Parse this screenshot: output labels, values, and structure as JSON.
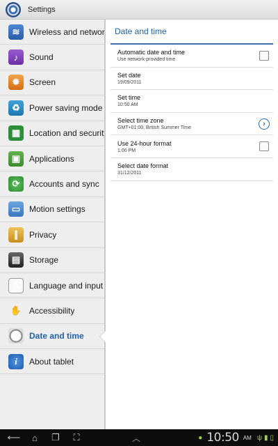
{
  "window": {
    "title": "Settings"
  },
  "sidebar": {
    "items": [
      {
        "label": "Wireless and networks",
        "icon": "wifi-icon",
        "glyph": "≋"
      },
      {
        "label": "Sound",
        "icon": "sound-icon",
        "glyph": "♪"
      },
      {
        "label": "Screen",
        "icon": "screen-icon",
        "glyph": "✹"
      },
      {
        "label": "Power saving mode",
        "icon": "recycle-icon",
        "glyph": "♻"
      },
      {
        "label": "Location and security",
        "icon": "location-grid-icon",
        "glyph": "▦"
      },
      {
        "label": "Applications",
        "icon": "applications-icon",
        "glyph": "▣"
      },
      {
        "label": "Accounts and sync",
        "icon": "sync-icon",
        "glyph": "⟳"
      },
      {
        "label": "Motion settings",
        "icon": "tablet-motion-icon",
        "glyph": "▭"
      },
      {
        "label": "Privacy",
        "icon": "fence-icon",
        "glyph": "∥"
      },
      {
        "label": "Storage",
        "icon": "sd-card-icon",
        "glyph": "▤"
      },
      {
        "label": "Language and input",
        "icon": "keyboard-a-icon",
        "glyph": "A"
      },
      {
        "label": "Accessibility",
        "icon": "hand-icon",
        "glyph": "✋"
      },
      {
        "label": "Date and time",
        "icon": "clock-icon",
        "glyph": "◷",
        "active": true
      },
      {
        "label": "About tablet",
        "icon": "info-icon",
        "glyph": "i"
      }
    ]
  },
  "detail": {
    "header": "Date and time",
    "prefs": [
      {
        "title": "Automatic date and time",
        "summary": "Use network-provided time",
        "widget": "checkbox",
        "checked": false
      },
      {
        "title": "Set date",
        "summary": "19/09/2011",
        "widget": "none"
      },
      {
        "title": "Set time",
        "summary": "10:50 AM",
        "widget": "none"
      },
      {
        "title": "Select time zone",
        "summary": "GMT+01:00, British Summer Time",
        "widget": "chevron"
      },
      {
        "title": "Use 24-hour format",
        "summary": "1:00 PM",
        "widget": "checkbox",
        "checked": false
      },
      {
        "title": "Select date format",
        "summary": "31/12/2011",
        "widget": "none"
      }
    ]
  },
  "navbar": {
    "back_glyph": "⟵",
    "home_glyph": "⌂",
    "recent_glyph": "❐",
    "screenshot_glyph": "⛶",
    "up_glyph": "︿",
    "clock": "10:50",
    "ampm": "AM",
    "status_icons": [
      "android-icon",
      "usb-icon",
      "signal-icon",
      "battery-icon"
    ]
  },
  "colors": {
    "accent": "#2262a9",
    "divider": "#3b6fae"
  }
}
